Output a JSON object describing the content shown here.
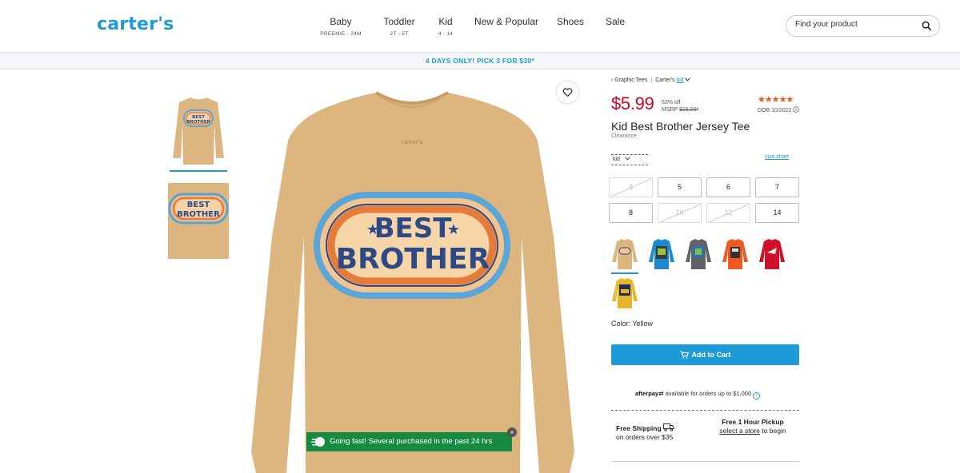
{
  "header": {
    "logo": "carter's",
    "nav": [
      {
        "label": "Baby",
        "sub": "PREEMIE - 24M"
      },
      {
        "label": "Toddler",
        "sub": "2T - 5T"
      },
      {
        "label": "Kid",
        "sub": "4 - 14"
      },
      {
        "label": "New & Popular",
        "sub": ""
      },
      {
        "label": "Shoes",
        "sub": ""
      },
      {
        "label": "Sale",
        "sub": ""
      }
    ],
    "search": {
      "placeholder": "Find your product",
      "icon": "search-icon"
    }
  },
  "promo": "4 DAYS ONLY! PICK 3 FOR $30*",
  "gallery": {
    "shirt_text_line1": "BEST",
    "shirt_text_line2": "BROTHER",
    "favorite_icon": "heart-icon",
    "brand_tag": "carter's"
  },
  "toast": {
    "message": "Going fast! Several purchased in the past 24 hrs",
    "close": "×"
  },
  "product": {
    "breadcrumb": {
      "back": "‹ Graphic Tees",
      "brand": "Carter's",
      "size_group": "kid"
    },
    "price": "$5.99",
    "percent_off": "63% off",
    "msrp_label": "MSRP",
    "msrp_value": "$16.00*",
    "rating_stars": "★★★★★",
    "rating": 4.5,
    "dob": "DOB 10/2022",
    "title": "Kid Best Brother Jersey Tee",
    "status": "Clearance",
    "size_select": "kid",
    "size_chart": "size chart",
    "sizes": [
      {
        "label": "4",
        "available": false
      },
      {
        "label": "5",
        "available": true
      },
      {
        "label": "6",
        "available": true
      },
      {
        "label": "7",
        "available": true
      },
      {
        "label": "8",
        "available": true
      },
      {
        "label": "10",
        "available": false
      },
      {
        "label": "12",
        "available": false
      },
      {
        "label": "14",
        "available": true
      }
    ],
    "colors": [
      {
        "name": "Tan",
        "hex": "#dcb57f"
      },
      {
        "name": "Blue",
        "hex": "#1b8ad2"
      },
      {
        "name": "Gray",
        "hex": "#5f6368"
      },
      {
        "name": "Orange",
        "hex": "#ee5a22"
      },
      {
        "name": "Red",
        "hex": "#d0102a"
      },
      {
        "name": "Yellow",
        "hex": "#e9b52c"
      }
    ],
    "color_label": "Color: Yellow",
    "add_to_cart": "Add to Cart",
    "afterpay_brand": "afterpay",
    "afterpay_text": "available for orders up to $1,000",
    "shipping_title": "Free Shipping",
    "shipping_sub": "on orders over $35",
    "pickup_title": "Free 1 Hour Pickup",
    "pickup_link": "select a store",
    "pickup_suffix": "to begin"
  },
  "colors": {
    "brand": "#1d9ad8",
    "price": "#d6001c",
    "toast": "#168a40",
    "stars": "#e8591a",
    "shirt": "#dcb57f"
  }
}
